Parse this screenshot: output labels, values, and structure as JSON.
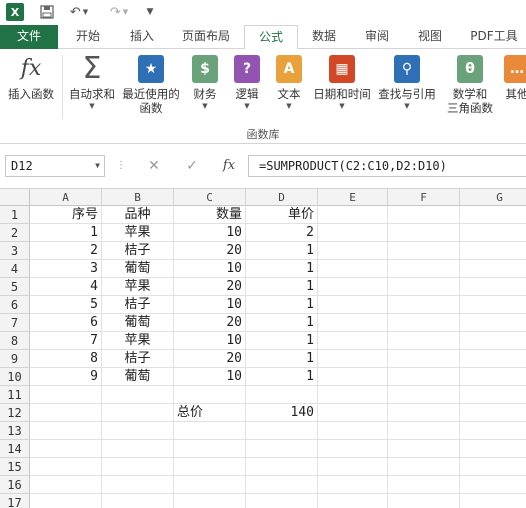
{
  "app": {
    "accent": "#217346"
  },
  "qat": {
    "icons": [
      "excel-logo-icon",
      "save-icon",
      "undo-icon",
      "redo-icon",
      "customize-qat-icon"
    ]
  },
  "tabs": [
    "文件",
    "开始",
    "插入",
    "页面布局",
    "公式",
    "数据",
    "审阅",
    "视图",
    "PDF工具"
  ],
  "active_tab": "公式",
  "ribbon": {
    "buttons": [
      {
        "line1": "插入函数",
        "line2": ""
      },
      {
        "line1": "自动求和",
        "line2": ""
      },
      {
        "line1": "最近使用的",
        "line2": "函数"
      },
      {
        "line1": "财务",
        "line2": ""
      },
      {
        "line1": "逻辑",
        "line2": ""
      },
      {
        "line1": "文本",
        "line2": ""
      },
      {
        "line1": "日期和时间",
        "line2": ""
      },
      {
        "line1": "查找与引用",
        "line2": ""
      },
      {
        "line1": "数学和",
        "line2": "三角函数"
      },
      {
        "line1": "其他",
        "line2": ""
      }
    ],
    "group_label": "函数库"
  },
  "formula_bar": {
    "name_box": "D12",
    "fx_label": "fx",
    "formula": "=SUMPRODUCT(C2:C10,D2:D10)"
  },
  "sheet": {
    "columns": [
      "A",
      "B",
      "C",
      "D",
      "E",
      "F",
      "G"
    ],
    "rows": [
      "1",
      "2",
      "3",
      "4",
      "5",
      "6",
      "7",
      "8",
      "9",
      "10",
      "11",
      "12",
      "13",
      "14",
      "15",
      "16",
      "17"
    ],
    "data": [
      [
        "序号",
        "品种",
        "数量",
        "单价"
      ],
      [
        "1",
        "苹果",
        "10",
        "2"
      ],
      [
        "2",
        "桔子",
        "20",
        "1"
      ],
      [
        "3",
        "葡萄",
        "10",
        "1"
      ],
      [
        "4",
        "苹果",
        "20",
        "1"
      ],
      [
        "5",
        "桔子",
        "10",
        "1"
      ],
      [
        "6",
        "葡萄",
        "20",
        "1"
      ],
      [
        "7",
        "苹果",
        "10",
        "1"
      ],
      [
        "8",
        "桔子",
        "20",
        "1"
      ],
      [
        "9",
        "葡萄",
        "10",
        "1"
      ]
    ],
    "total_label": "总价",
    "total_value": "140"
  }
}
